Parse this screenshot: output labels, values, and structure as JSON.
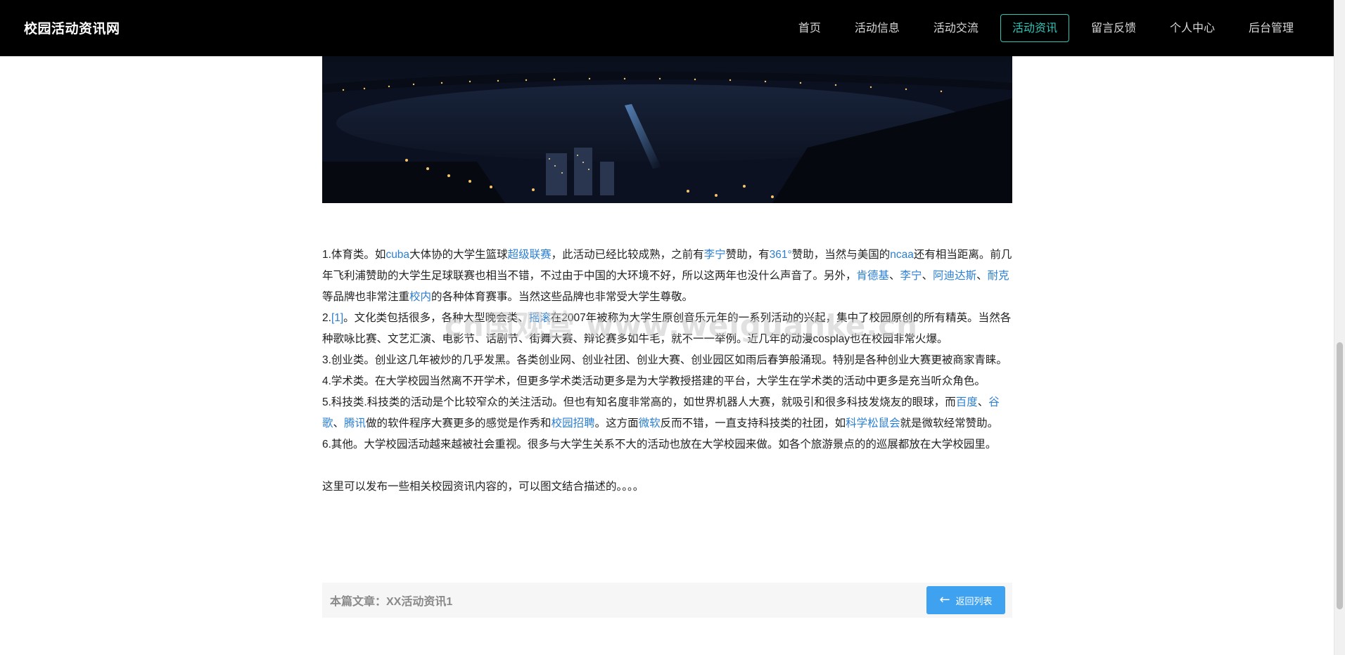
{
  "brand": "校园活动资讯网",
  "nav": {
    "items": [
      "首页",
      "活动信息",
      "活动交流",
      "活动资讯",
      "留言反馈",
      "个人中心",
      "后台管理"
    ],
    "active": "活动资讯"
  },
  "article": {
    "p1": {
      "t1": "1.体育类。如",
      "l1": "cuba",
      "t2": "大体协的大学生篮球",
      "l2": "超级联赛",
      "t3": "，此活动已经比较成熟，之前有",
      "l3": "李宁",
      "t4": "赞助，有",
      "l4": "361°",
      "t5": "赞助，当然与美国的",
      "l5": "ncaa",
      "t6": "还有相当距离。前几年飞利浦赞助的大学生足球联赛也相当不错，不过由于中国的大环境不好，所以这两年也没什么声音了。另外，",
      "l6": "肯德基",
      "t7": "、",
      "l7": "李宁",
      "t8": "、",
      "l8": "阿迪达斯",
      "t9": "、",
      "l9": "耐克",
      "t10": "等品牌也非常注重",
      "l10": "校内",
      "t11": "的各种体育赛事。当然这些品牌也非常受大学生尊敬。"
    },
    "p2": {
      "t1": "2.",
      "l1": "[1]",
      "t2": "。文化类包括很多，各种大型晚会类、",
      "l2": "摇滚",
      "t3": "在2007年被称为大学生原创音乐元年的一系列活动的兴起，集中了校园原创的所有精英。当然各种歌咏比赛、文艺汇演、电影节、话剧节、街舞大赛、辩论赛多如牛毛，就不一一举例。近几年的动漫cosplay也在校园非常火爆。"
    },
    "p3": "3.创业类。创业这几年被炒的几乎发黑。各类创业网、创业社团、创业大赛、创业园区如雨后春笋般涌现。特别是各种创业大赛更被商家青睐。",
    "p4": "4.学术类。在大学校园当然离不开学术，但更多学术类活动更多是为大学教授搭建的平台，大学生在学术类的活动中更多是充当听众角色。",
    "p5": {
      "t1": "5.科技类.科技类的活动是个比较窄众的关注活动。但也有知名度非常高的，如世界机器人大赛，就吸引和很多科技发烧友的眼球，而",
      "l1": "百度",
      "t2": "、",
      "l2": "谷歌",
      "t3": "、",
      "l3": "腾讯",
      "t4": "做的软件程序大赛更多的感觉是作秀和",
      "l4": "校园招聘",
      "t5": "。这方面",
      "l5": "微软",
      "t6": "反而不错，一直支持科技类的社团，如",
      "l6": "科学松鼠会",
      "t7": "就是微软经常赞助。"
    },
    "p6": "6.其他。大学校园活动越来越被社会重视。很多与大学生关系不大的活动也放在大学校园来做。如各个旅游景点的的巡展都放在大学校园里。",
    "p7": "这里可以发布一些相关校园资讯内容的，可以图文结合描述的。。。。"
  },
  "footer": {
    "article_label": "本篇文章：XX活动资讯1",
    "back_button": "返回列表",
    "back_icon": "arrow-left-icon"
  },
  "watermark": "cn国观营 www.weiguanke.cn",
  "colors": {
    "navbar_bg": "#000000",
    "active_nav": "#2ec4b6",
    "link": "#2b7fd1",
    "button": "#3ea2f0"
  }
}
